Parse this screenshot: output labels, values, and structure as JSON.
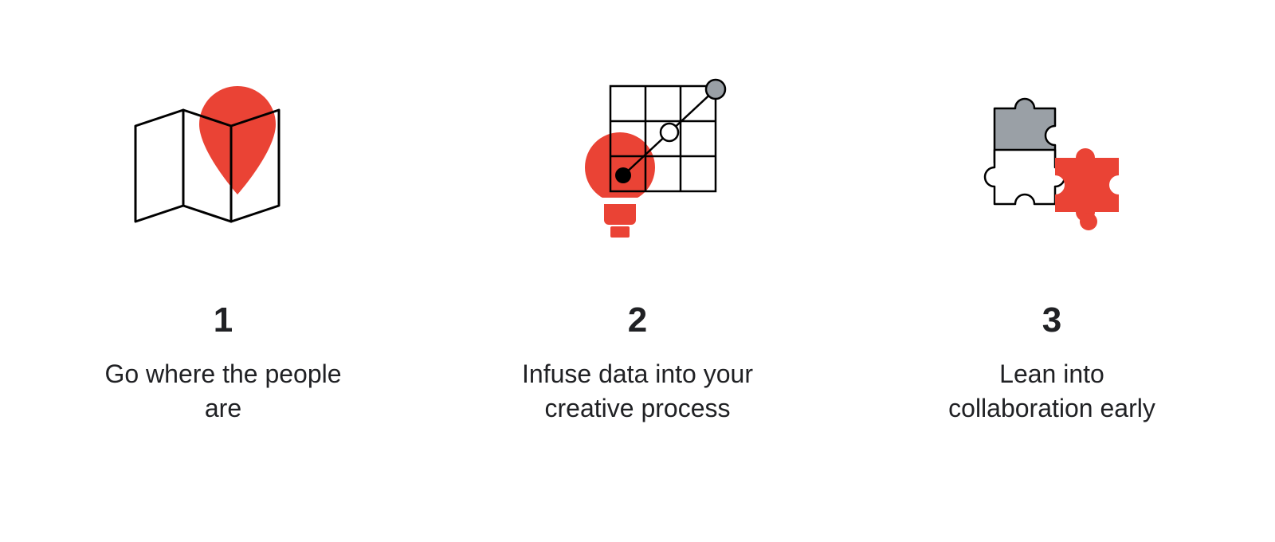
{
  "colors": {
    "red": "#EA4335",
    "black": "#000000",
    "grey": "#9AA0A6",
    "white": "#FFFFFF"
  },
  "items": [
    {
      "number": "1",
      "label": "Go where the people are",
      "icon": "map-pin-icon"
    },
    {
      "number": "2",
      "label": "Infuse data into your creative process",
      "icon": "bulb-grid-icon"
    },
    {
      "number": "3",
      "label": "Lean into collaboration early",
      "icon": "puzzle-icon"
    }
  ]
}
